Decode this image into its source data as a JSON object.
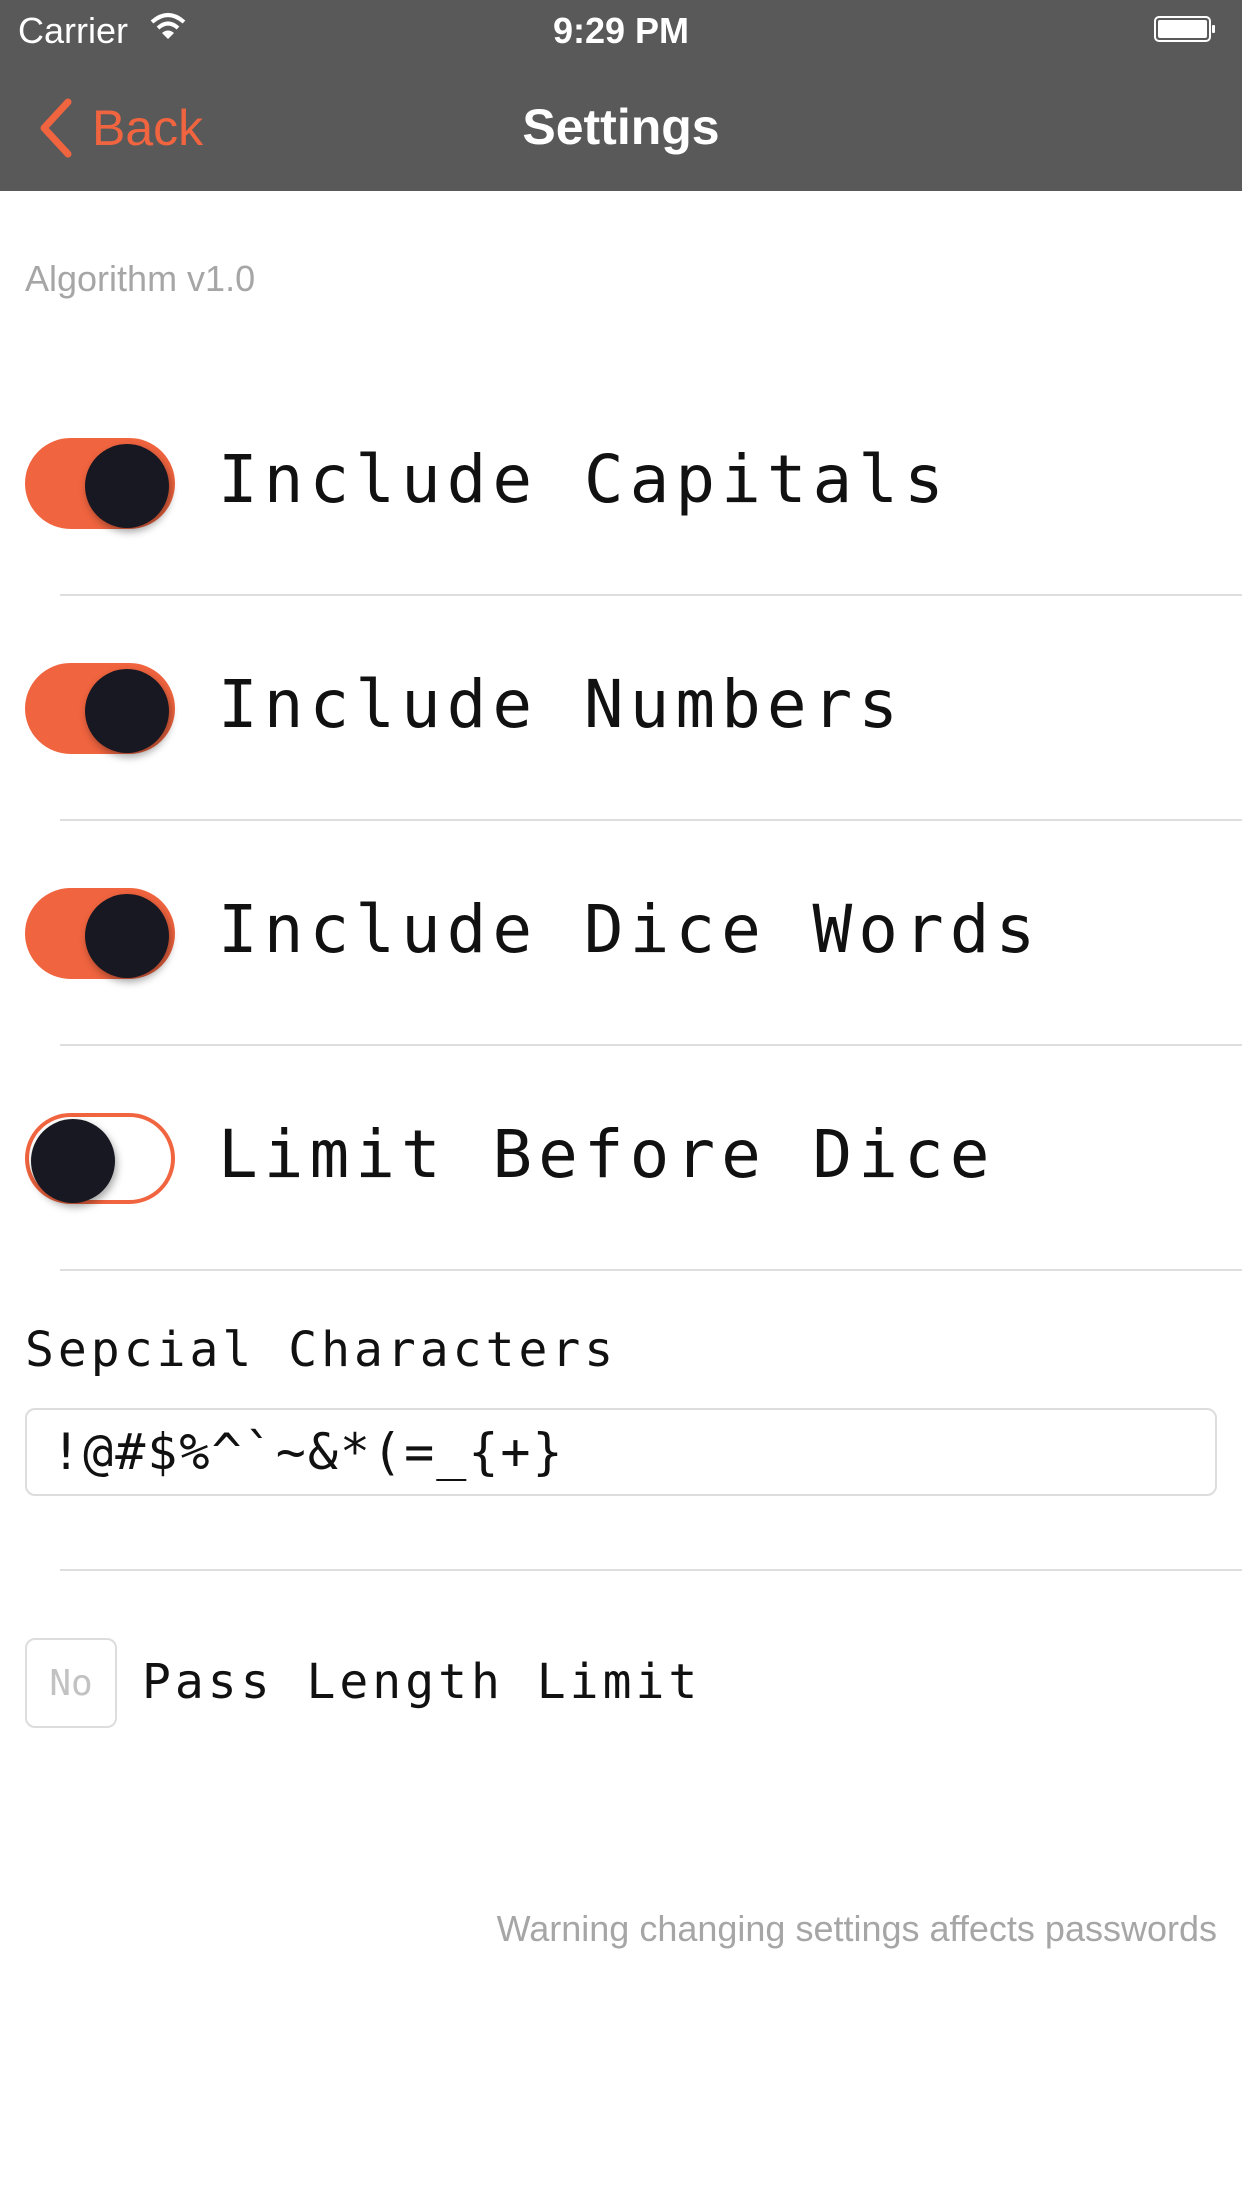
{
  "status_bar": {
    "carrier": "Carrier",
    "time": "9:29 PM",
    "wifi_icon": "wifi-icon",
    "battery_icon": "battery-icon"
  },
  "nav": {
    "back_label": "Back",
    "back_icon": "chevron-left-icon",
    "title": "Settings"
  },
  "version": "Algorithm v1.0",
  "toggles": [
    {
      "label": "Include Capitals",
      "on": true
    },
    {
      "label": "Include Numbers",
      "on": true
    },
    {
      "label": "Include Dice Words",
      "on": true
    },
    {
      "label": "Limit Before Dice",
      "on": false
    }
  ],
  "special": {
    "label": "Sepcial Characters",
    "value": "!@#$%^`~&*(=_{+}"
  },
  "pass_limit": {
    "placeholder": "No",
    "label": "Pass Length Limit"
  },
  "warning": "Warning changing settings affects passwords",
  "colors": {
    "accent": "#f0643f",
    "bar": "#595959",
    "knob": "#181822",
    "muted": "#a6a6a6"
  }
}
